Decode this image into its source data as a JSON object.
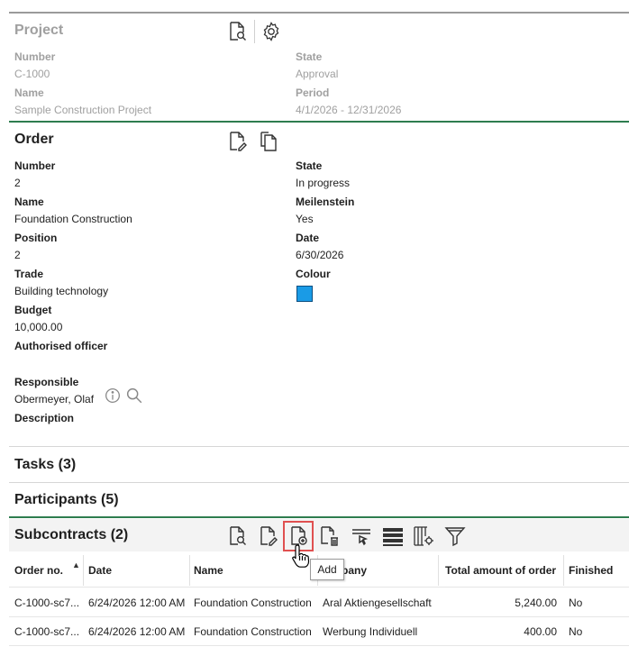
{
  "project": {
    "title": "Project",
    "number_label": "Number",
    "number": "C-1000",
    "state_label": "State",
    "state": "Approval",
    "name_label": "Name",
    "name": "Sample Construction Project",
    "period_label": "Period",
    "period": "4/1/2026 - 12/31/2026"
  },
  "order": {
    "title": "Order",
    "number_label": "Number",
    "number": "2",
    "state_label": "State",
    "state": "In progress",
    "name_label": "Name",
    "name": "Foundation Construction",
    "milestone_label": "Meilenstein",
    "milestone": "Yes",
    "position_label": "Position",
    "position": "2",
    "date_label": "Date",
    "date": "6/30/2026",
    "trade_label": "Trade",
    "trade": "Building technology",
    "colour_label": "Colour",
    "colour": "#1a9be6",
    "budget_label": "Budget",
    "budget": "10,000.00",
    "officer_label": "Authorised officer",
    "responsible_label": "Responsible",
    "responsible": "Obermeyer, Olaf",
    "description_label": "Description"
  },
  "sections": {
    "tasks": "Tasks (3)",
    "participants": "Participants (5)",
    "subcontracts": "Subcontracts (2)"
  },
  "table": {
    "headers": [
      "Order no.",
      "Date",
      "Name",
      "Company",
      "Total amount of order",
      "Finished"
    ],
    "header_company_visible": "pany",
    "rows": [
      [
        "C-1000-sc7...",
        "6/24/2026 12:00 AM",
        "Foundation Construction",
        "Aral Aktiengesellschaft",
        "5,240.00",
        "No"
      ],
      [
        "C-1000-sc7...",
        "6/24/2026 12:00 AM",
        "Foundation Construction",
        "Werbung Individuell",
        "400.00",
        "No"
      ]
    ]
  },
  "tooltip": "Add"
}
